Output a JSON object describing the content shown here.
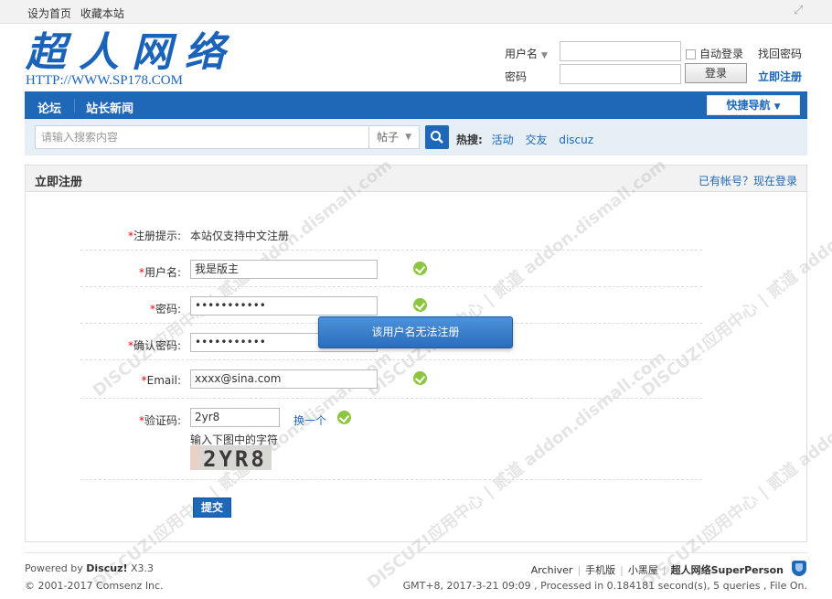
{
  "topbar": {
    "set_home": "设为首页",
    "bookmark": "收藏本站"
  },
  "logo": {
    "cn": "超人网络",
    "en": "HTTP://WWW.SP178.COM"
  },
  "login": {
    "user_label": "用户名",
    "pass_label": "密码",
    "auto_login": "自动登录",
    "forgot": "找回密码",
    "login_btn": "登录",
    "register": "立即注册"
  },
  "nav": {
    "items": [
      "论坛",
      "站长新闻"
    ],
    "quick_nav": "快捷导航"
  },
  "search": {
    "placeholder": "请输入搜索内容",
    "type": "帖子",
    "hot_label": "热搜:",
    "hot_keywords": [
      "活动",
      "交友",
      "discuz"
    ]
  },
  "panel": {
    "title": "立即注册",
    "have_account": "已有帐号？现在登录",
    "rows": {
      "hint_label": "注册提示:",
      "hint_value": "本站仅支持中文注册",
      "username_label": "用户名:",
      "username_value": "我是版主",
      "password_label": "密码:",
      "password_value": "•••••••••••",
      "confirm_label": "确认密码:",
      "confirm_value": "•••••••••••",
      "email_label": "Email:",
      "email_value": "xxxx@sina.com",
      "captcha_label": "验证码:",
      "captcha_value": "2yr8",
      "captcha_change": "换一个",
      "captcha_hint": "输入下图中的字符",
      "captcha_image_text": "2YR8"
    },
    "submit": "提交"
  },
  "toast": "该用户名无法注册",
  "footer": {
    "powered": "Powered by ",
    "powered_brand": "Discuz!",
    "powered_ver": " X3.3",
    "copyright": "© 2001-2017 Comsenz Inc.",
    "links": [
      "Archiver",
      "手机版",
      "小黑屋"
    ],
    "site_name": "超人网络SuperPerson",
    "status": "GMT+8, 2017-3-21 09:09 , Processed in 0.184181 second(s), 5 queries , File On."
  },
  "watermark": "DISCUZ!应用中心 | 贰道 addon.dismall.com",
  "colors": {
    "brand": "#1f68b8",
    "required": "#ff0000",
    "ok": "#8cc63f"
  }
}
